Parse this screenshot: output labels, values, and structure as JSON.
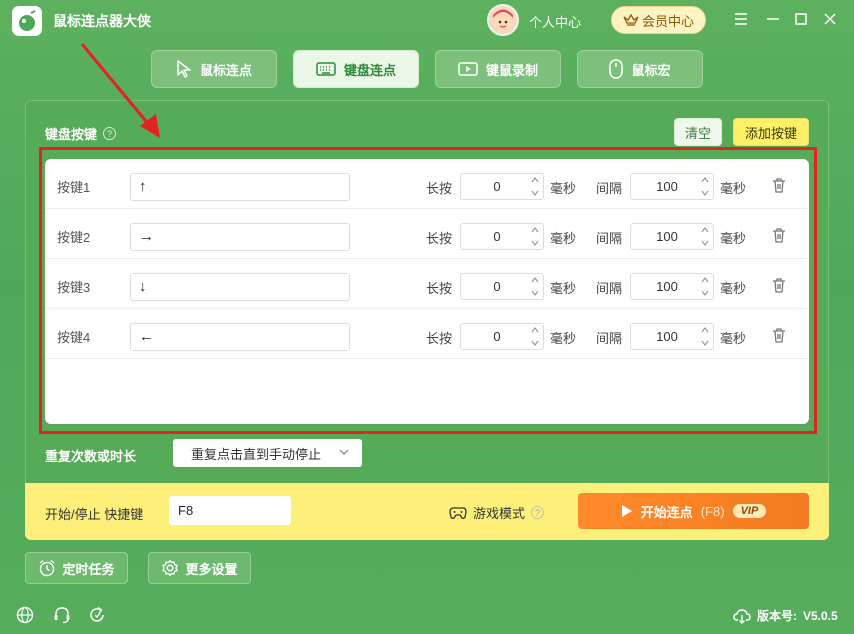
{
  "app": {
    "title": "鼠标连点器大侠"
  },
  "header": {
    "user_center": "个人中心",
    "vip_center": "会员中心"
  },
  "nav": {
    "tabs": [
      {
        "label": "鼠标连点",
        "icon": "cursor-icon",
        "active": false
      },
      {
        "label": "键盘连点",
        "icon": "keyboard-icon",
        "active": true
      },
      {
        "label": "键鼠录制",
        "icon": "record-icon",
        "active": false
      },
      {
        "label": "鼠标宏",
        "icon": "mouse-icon",
        "active": false
      }
    ]
  },
  "keys_section": {
    "title": "键盘按键",
    "clear_label": "清空",
    "add_label": "添加按键",
    "hold_label": "长按",
    "interval_label": "间隔",
    "ms_unit": "毫秒",
    "rows": [
      {
        "label": "按键1",
        "key": "↑",
        "hold": "0",
        "interval": "100"
      },
      {
        "label": "按键2",
        "key": "→",
        "hold": "0",
        "interval": "100"
      },
      {
        "label": "按键3",
        "key": "↓",
        "hold": "0",
        "interval": "100"
      },
      {
        "label": "按键4",
        "key": "←",
        "hold": "0",
        "interval": "100"
      }
    ]
  },
  "repeat": {
    "label": "重复次数或时长",
    "selected": "重复点击直到手动停止"
  },
  "bottom": {
    "hotkey_label": "开始/停止 快捷键",
    "hotkey_value": "F8",
    "game_mode": "游戏模式",
    "start_label": "开始连点",
    "start_hotkey": "(F8)",
    "vip_badge": "VIP"
  },
  "footer": {
    "scheduled_task": "定时任务",
    "more_settings": "更多设置",
    "version_label": "版本号:",
    "version": "V5.0.5"
  },
  "colors": {
    "brand_green": "#55ab58",
    "accent_yellow": "#fdf07a",
    "start_orange": "#f47b20",
    "annotation_red": "#e52222"
  }
}
